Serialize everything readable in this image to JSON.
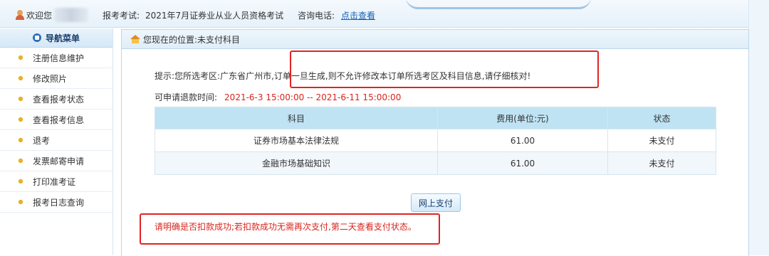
{
  "header": {
    "welcome": "欢迎您",
    "exam_label": "报考考试:",
    "exam_value": "2021年7月证券业从业人员资格考试",
    "consult_label": "咨询电话:",
    "consult_link": "点击查看"
  },
  "sidebar": {
    "title": "导航菜单",
    "items": [
      {
        "label": "注册信息维护"
      },
      {
        "label": "修改照片"
      },
      {
        "label": "查看报考状态"
      },
      {
        "label": "查看报考信息"
      },
      {
        "label": "退考"
      },
      {
        "label": "发票邮寄申请"
      },
      {
        "label": "打印准考证"
      },
      {
        "label": "报考日志查询"
      }
    ]
  },
  "main": {
    "breadcrumb": "您现在的位置:未支付科目",
    "notice_prefix": "提示:您所选考区:广东省广州市,",
    "notice_highlight": "订单一旦生成,则不允许修改本订单所选考区及科目信息,请仔细核对!",
    "refund_label": "可申请退款时间:",
    "refund_time": "2021-6-3 15:00:00 -- 2021-6-11 15:00:00",
    "table": {
      "headers": [
        "科目",
        "费用(单位:元)",
        "状态"
      ],
      "rows": [
        [
          "证券市场基本法律法规",
          "61.00",
          "未支付"
        ],
        [
          "金融市场基础知识",
          "61.00",
          "未支付"
        ]
      ]
    },
    "pay_button": "网上支付",
    "warning": "请明确是否扣款成功;若扣款成功无需再次支付,第二天查看支付状态。"
  },
  "colors": {
    "accent": "#bfe3f3",
    "warning": "#d9241d",
    "annotation": "#e32323",
    "link": "#1a5fb4"
  }
}
